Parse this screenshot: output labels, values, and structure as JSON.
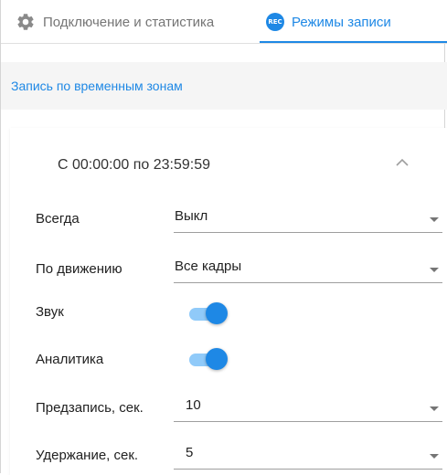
{
  "tabs": [
    {
      "label": "Подключение и статистика",
      "icon": "gear-icon",
      "active": false
    },
    {
      "label": "Режимы записи",
      "icon": "rec-icon",
      "icon_text": "REC",
      "active": true
    }
  ],
  "colors": {
    "accent": "#1e88e5",
    "accent_light": "#90caf9",
    "section_bg": "#f5f5f5"
  },
  "section": {
    "title": "Запись по временным зонам"
  },
  "schedule": {
    "range": "С 00:00:00  по 23:59:59",
    "collapse_icon": "chevron-up-icon"
  },
  "fields": {
    "always": {
      "label": "Всегда",
      "value": "Выкл"
    },
    "motion": {
      "label": "По движению",
      "value": "Все кадры"
    },
    "sound": {
      "label": "Звук",
      "enabled": true
    },
    "analytics": {
      "label": "Аналитика",
      "enabled": true
    },
    "prerecord": {
      "label": "Предзапись, сек.",
      "value": "10"
    },
    "hold": {
      "label": "Удержание, сек.",
      "value": "5"
    }
  }
}
